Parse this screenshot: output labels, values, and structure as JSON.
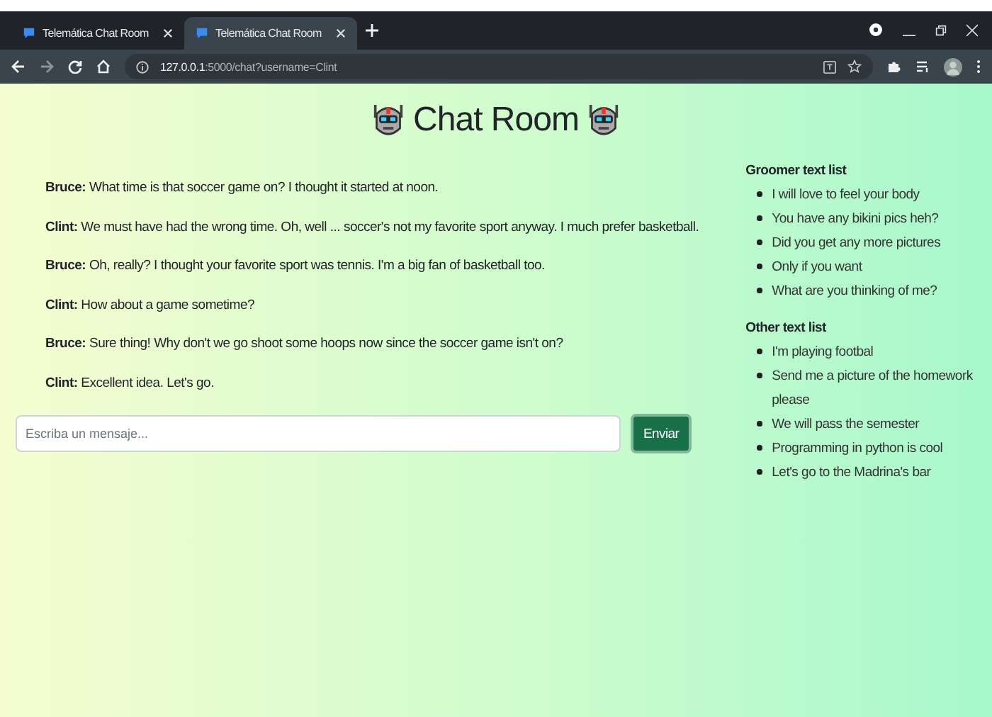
{
  "browser": {
    "tabs": [
      {
        "title": "Telemática Chat Room",
        "selected": false
      },
      {
        "title": "Telemática Chat Room",
        "selected": true
      }
    ],
    "address_host": "127.0.0.1",
    "address_path": ":5000/chat?username=Clint"
  },
  "title": "Chat Room",
  "messages": [
    {
      "sender": "Bruce:",
      "text": "What time is that soccer game on? I thought it started at noon."
    },
    {
      "sender": "Clint:",
      "text": "We must have had the wrong time. Oh, well ... soccer's not my favorite sport anyway. I much prefer basketball."
    },
    {
      "sender": "Bruce:",
      "text": "Oh, really? I thought your favorite sport was tennis. I'm a big fan of basketball too."
    },
    {
      "sender": "Clint:",
      "text": "How about a game sometime?"
    },
    {
      "sender": "Bruce:",
      "text": "Sure thing! Why don't we go shoot some hoops now since the soccer game isn't on?"
    },
    {
      "sender": "Clint:",
      "text": "Excellent idea. Let's go."
    }
  ],
  "composer": {
    "placeholder": "Escriba un mensaje...",
    "button": "Enviar"
  },
  "lists": [
    {
      "heading": "Groomer text list",
      "items": [
        "I will love to feel your body",
        "You have any bikini pics heh?",
        "Did you get any more pictures",
        "Only if you want",
        "What are you thinking of me?"
      ]
    },
    {
      "heading": "Other text list",
      "items": [
        "I'm playing footbal",
        "Send me a picture of the homework please",
        "We will pass the semester",
        "Programming in python is cool",
        "Let's go to the Madrina's bar"
      ]
    }
  ]
}
